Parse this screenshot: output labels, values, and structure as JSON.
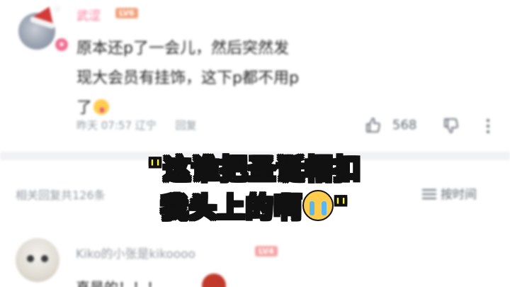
{
  "comment": {
    "username": "武涩",
    "level": "LV6",
    "text": "原本还p了一会儿，然后突然发现大会员有挂饰，这下p都不用p了",
    "time": "昨天 07:57",
    "location": "辽宁",
    "reply_label": "回复",
    "likes": "568"
  },
  "replies_bar": {
    "count_text": "相关回复共126条",
    "sort_label": "按时间"
  },
  "reply": {
    "username": "Kiko的小张是kikoooo",
    "level": "LV4",
    "text": "真是的！！！"
  },
  "caption": {
    "line1": "\"这谁把圣诞帽扣",
    "line2": "我头上的啊",
    "line2_end": "\""
  },
  "colors": {
    "username_pink": "#fb7299",
    "caption_yellow": "#fff34a",
    "muted_gray": "#9499a0"
  },
  "icons": [
    "santa-hat-icon",
    "vip-badge-icon",
    "like-icon",
    "dislike-icon",
    "more-icon",
    "sort-icon",
    "smile-emoji-icon",
    "crying-emoji-icon"
  ]
}
